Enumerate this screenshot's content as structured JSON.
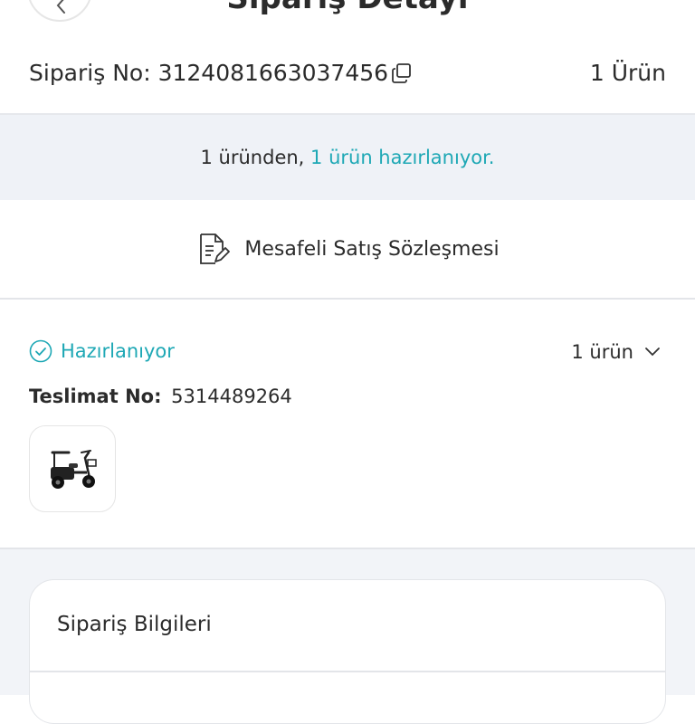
{
  "header": {
    "title": "Sipariş Detayı",
    "back_icon": "chevron-left-icon"
  },
  "order": {
    "number_label": "Sipariş No: 3124081663037456",
    "copy_icon": "copy-icon",
    "item_count": "1 Ürün"
  },
  "banner": {
    "prefix": "1 üründen, ",
    "highlight": "1 ürün hazırlanıyor.",
    "highlight_color": "#1ea8b5"
  },
  "contract": {
    "label": "Mesafeli Satış Sözleşmesi",
    "icon": "document-edit-icon"
  },
  "shipment": {
    "status": "Hazırlanıyor",
    "status_icon": "check-circle-icon",
    "count": "1 ürün",
    "expand_icon": "chevron-down-icon",
    "delivery_label": "Teslimat No:",
    "delivery_number": "5314489264",
    "product_image": "electric-tricycle"
  },
  "order_info": {
    "title": "Sipariş Bilgileri"
  }
}
